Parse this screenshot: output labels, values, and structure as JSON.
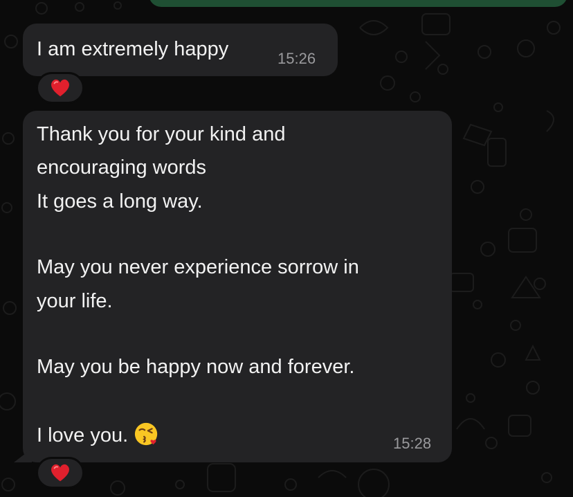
{
  "colors": {
    "background": "#0b0b0b",
    "bubble": "#232325",
    "sent_bubble": "#1f4f33",
    "text": "#f2f2f2",
    "timestamp": "#9a9a9d",
    "heart": "#e0202d"
  },
  "messages": [
    {
      "text": "I am extremely happy",
      "time": "15:26",
      "reaction": "heart-icon"
    },
    {
      "lines": [
        "Thank you for your kind and",
        "encouraging words",
        "It goes a long way.",
        "",
        "May you never experience sorrow in",
        "your life.",
        "",
        "May you be happy now and forever.",
        "",
        "I love you."
      ],
      "emoji": "face-blowing-kiss-icon",
      "time": "15:28",
      "reaction": "heart-icon"
    }
  ]
}
